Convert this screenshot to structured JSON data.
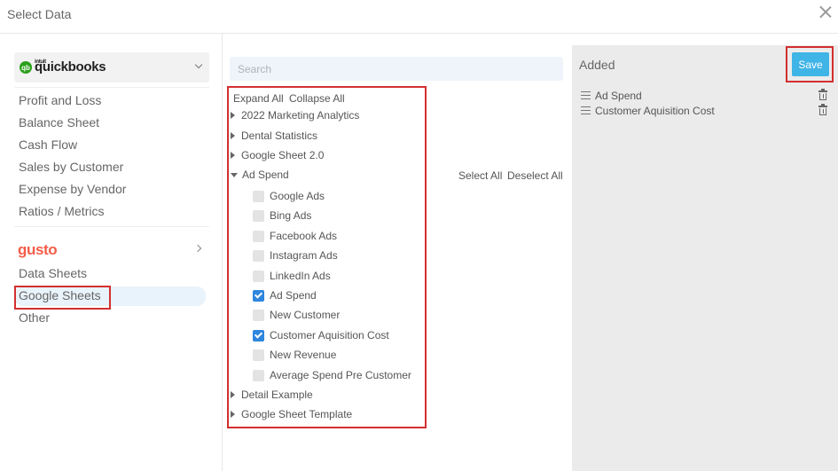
{
  "window": {
    "title": "Select Data"
  },
  "sidebar": {
    "quickbooks": {
      "intuit": "intuit",
      "brand": "quickbooks",
      "logo_mark": "qb"
    },
    "qb_items": [
      "Profit and Loss",
      "Balance Sheet",
      "Cash Flow",
      "Sales by Customer",
      "Expense by Vendor",
      "Ratios / Metrics"
    ],
    "gusto": "gusto",
    "other_items": [
      "Data Sheets",
      "Google Sheets",
      "Other"
    ],
    "selected": "Google Sheets"
  },
  "middle": {
    "search_placeholder": "Search",
    "expand_all": "Expand All",
    "collapse_all": "Collapse All",
    "select_all": "Select All",
    "deselect_all": "Deselect All",
    "nodes": [
      {
        "label": "2022 Marketing Analytics",
        "expanded": false
      },
      {
        "label": "Dental Statistics",
        "expanded": false
      },
      {
        "label": "Google Sheet 2.0",
        "expanded": false
      },
      {
        "label": "Ad Spend",
        "expanded": true
      },
      {
        "label": "Detail Example",
        "expanded": false
      },
      {
        "label": "Google Sheet Template",
        "expanded": false
      }
    ],
    "ad_spend_children": [
      {
        "label": "Google Ads",
        "checked": false
      },
      {
        "label": "Bing Ads",
        "checked": false
      },
      {
        "label": "Facebook Ads",
        "checked": false
      },
      {
        "label": "Instagram Ads",
        "checked": false
      },
      {
        "label": "LinkedIn Ads",
        "checked": false
      },
      {
        "label": "Ad Spend",
        "checked": true
      },
      {
        "label": "New Customer",
        "checked": false
      },
      {
        "label": "Customer Aquisition Cost",
        "checked": true
      },
      {
        "label": "New Revenue",
        "checked": false
      },
      {
        "label": "Average Spend Pre Customer",
        "checked": false
      }
    ]
  },
  "right": {
    "title": "Added",
    "save_label": "Save",
    "items": [
      "Ad Spend",
      "Customer Aquisition Cost"
    ]
  },
  "colors": {
    "accent_blue": "#3fb4e6",
    "checkbox_blue": "#2f86de",
    "highlight_red": "#d32f2f",
    "gusto": "#f45d48",
    "qb_green": "#2ca01c"
  }
}
